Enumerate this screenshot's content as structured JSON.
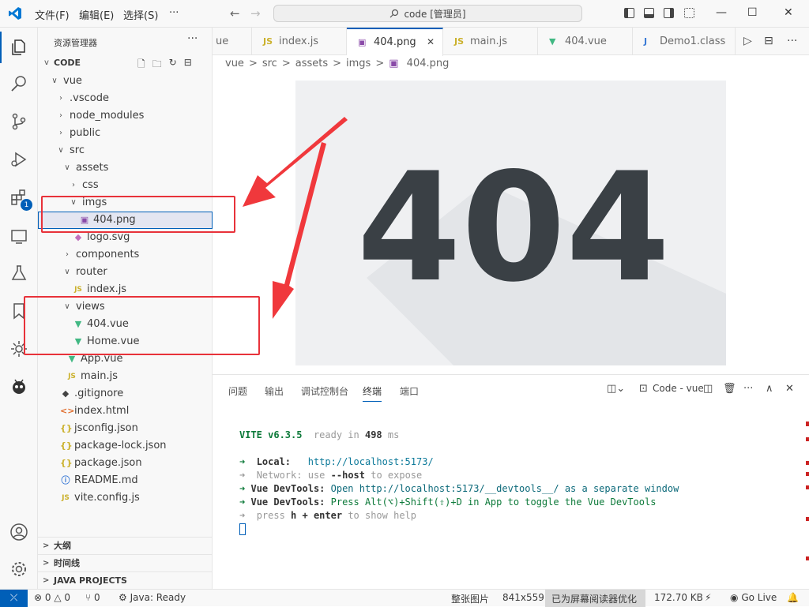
{
  "titlebar": {
    "menus": [
      "文件(F)",
      "编辑(E)",
      "选择(S)"
    ],
    "more": "···",
    "back": "←",
    "forward": "→",
    "search": "code [管理员]",
    "min": "—",
    "max": "☐",
    "close": "✕"
  },
  "activity": {
    "extensions_badge": "1"
  },
  "sidebar": {
    "title": "资源管理器",
    "more": "···",
    "root": "CODE",
    "tree": [
      {
        "label": "vue",
        "depth": 1,
        "chev": "v",
        "icon": ""
      },
      {
        "label": ".vscode",
        "depth": 2,
        "chev": ">",
        "icon": ""
      },
      {
        "label": "node_modules",
        "depth": 2,
        "chev": ">",
        "icon": ""
      },
      {
        "label": "public",
        "depth": 2,
        "chev": ">",
        "icon": ""
      },
      {
        "label": "src",
        "depth": 2,
        "chev": "v",
        "icon": ""
      },
      {
        "label": "assets",
        "depth": 3,
        "chev": "v",
        "icon": ""
      },
      {
        "label": "css",
        "depth": 4,
        "chev": ">",
        "icon": ""
      },
      {
        "label": "imgs",
        "depth": 4,
        "chev": "v",
        "icon": ""
      },
      {
        "label": "404.png",
        "depth": 5,
        "chev": "",
        "icon": "img",
        "selected": true
      },
      {
        "label": "logo.svg",
        "depth": 4,
        "chev": "",
        "icon": "svg"
      },
      {
        "label": "components",
        "depth": 3,
        "chev": ">",
        "icon": ""
      },
      {
        "label": "router",
        "depth": 3,
        "chev": "v",
        "icon": ""
      },
      {
        "label": "index.js",
        "depth": 4,
        "chev": "",
        "icon": "js"
      },
      {
        "label": "views",
        "depth": 3,
        "chev": "v",
        "icon": ""
      },
      {
        "label": "404.vue",
        "depth": 4,
        "chev": "",
        "icon": "vue"
      },
      {
        "label": "Home.vue",
        "depth": 4,
        "chev": "",
        "icon": "vue"
      },
      {
        "label": "App.vue",
        "depth": 3,
        "chev": "",
        "icon": "vue"
      },
      {
        "label": "main.js",
        "depth": 3,
        "chev": "",
        "icon": "js"
      },
      {
        "label": ".gitignore",
        "depth": 2,
        "chev": "",
        "icon": "git"
      },
      {
        "label": "index.html",
        "depth": 2,
        "chev": "",
        "icon": "html"
      },
      {
        "label": "jsconfig.json",
        "depth": 2,
        "chev": "",
        "icon": "json"
      },
      {
        "label": "package-lock.json",
        "depth": 2,
        "chev": "",
        "icon": "json"
      },
      {
        "label": "package.json",
        "depth": 2,
        "chev": "",
        "icon": "json"
      },
      {
        "label": "README.md",
        "depth": 2,
        "chev": "",
        "icon": "info"
      },
      {
        "label": "vite.config.js",
        "depth": 2,
        "chev": "",
        "icon": "js"
      }
    ],
    "sections": [
      "大纲",
      "时间线",
      "JAVA PROJECTS"
    ]
  },
  "tabs": [
    {
      "label": "ue",
      "icon": "",
      "active": false
    },
    {
      "label": "index.js",
      "icon": "JS",
      "active": false
    },
    {
      "label": "404.png",
      "icon": "img",
      "active": true
    },
    {
      "label": "main.js",
      "icon": "JS",
      "active": false
    },
    {
      "label": "404.vue",
      "icon": "vue",
      "active": false
    },
    {
      "label": "Demo1.class",
      "icon": "J",
      "active": false
    }
  ],
  "breadcrumb": [
    "vue",
    ">",
    "src",
    ">",
    "assets",
    ">",
    "imgs",
    ">",
    "404.png"
  ],
  "image": {
    "text": "404"
  },
  "panel": {
    "tabs": [
      "问题",
      "输出",
      "调试控制台",
      "终端",
      "端口"
    ],
    "active": "终端",
    "terminal_name": "Code - vue",
    "lines": {
      "vite": "VITE v6.3.5",
      "ready": "ready in",
      "ms_value": "498",
      "ms": "ms",
      "local_label": "Local:",
      "local_url": "http://localhost:5173/",
      "network": "Network:",
      "network_rest": "use",
      "host": "--host",
      "expose": "to expose",
      "devtools1_label": "Vue DevTools:",
      "devtools1": "Open http://localhost:5173/__devtools__/ as a separate window",
      "devtools2_label": "Vue DevTools:",
      "devtools2": "Press Alt(⌥)+Shift(⇧)+D in App to toggle the Vue DevTools",
      "help_press": "press",
      "help_key": "h + enter",
      "help_rest": "to show help"
    }
  },
  "status": {
    "errors": "0",
    "warnings": "0",
    "ports": "0",
    "java": "Java: Ready",
    "whole": "整张图片",
    "dims": "841x559",
    "reader": "已为屏幕阅读器优化",
    "size": "172.70 KB",
    "golive": "Go Live"
  },
  "colors": {
    "accent": "#005fb8",
    "annotation": "#e8323a",
    "vue": "#41b883",
    "js": "#cbb12c"
  }
}
